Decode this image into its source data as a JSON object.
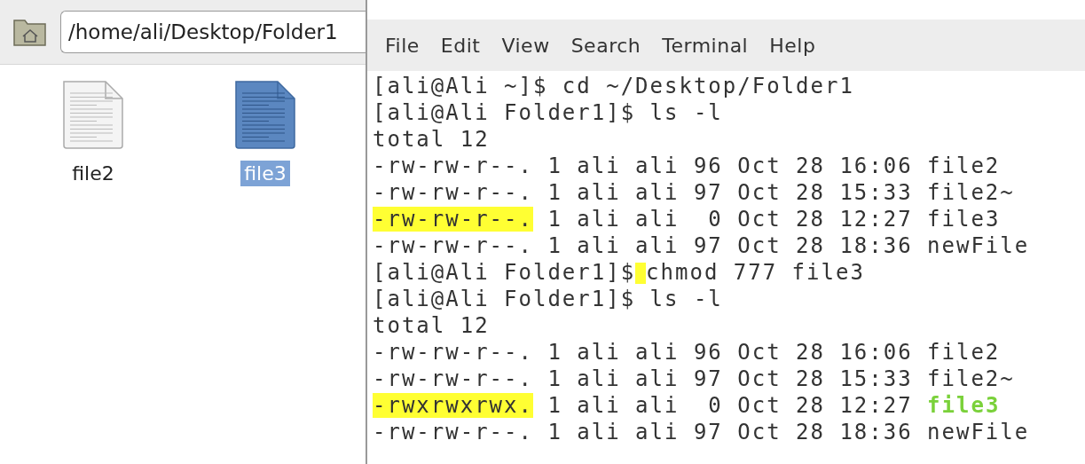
{
  "file_manager": {
    "location": "/home/ali/Desktop/Folder1",
    "files": [
      {
        "name": "file2",
        "selected": false
      },
      {
        "name": "file3",
        "selected": true
      }
    ]
  },
  "terminal": {
    "menu": [
      "File",
      "Edit",
      "View",
      "Search",
      "Terminal",
      "Help"
    ],
    "lines": [
      {
        "segments": [
          {
            "text": "[ali@Ali ~]$ cd ~/Desktop/Folder1",
            "kind": "plain",
            "highlighted": false
          }
        ]
      },
      {
        "segments": [
          {
            "text": "[ali@Ali Folder1]$ ls -l",
            "kind": "plain",
            "highlighted": false
          }
        ]
      },
      {
        "segments": [
          {
            "text": "total 12",
            "kind": "plain",
            "highlighted": false
          }
        ]
      },
      {
        "segments": [
          {
            "text": "-rw-rw-r--. 1 ali ali 96 Oct 28 16:06 file2",
            "kind": "plain",
            "highlighted": false
          }
        ]
      },
      {
        "segments": [
          {
            "text": "-rw-rw-r--. 1 ali ali 97 Oct 28 15:33 file2~",
            "kind": "plain",
            "highlighted": false
          }
        ]
      },
      {
        "segments": [
          {
            "text": "-rw-rw-r--.",
            "kind": "plain",
            "highlighted": true
          },
          {
            "text": " 1 ali ali  0 Oct 28 12:27 file3",
            "kind": "plain",
            "highlighted": false
          }
        ]
      },
      {
        "segments": [
          {
            "text": "-rw-rw-r--. 1 ali ali 97 Oct 28 18:36 newFile",
            "kind": "plain",
            "highlighted": false
          }
        ]
      },
      {
        "segments": [
          {
            "text": "[ali@Ali Folder1]$",
            "kind": "plain",
            "highlighted": false
          },
          {
            "kind": "cursor",
            "highlighted": true
          },
          {
            "text": "chmod 777 file3",
            "kind": "plain",
            "highlighted": false
          }
        ]
      },
      {
        "segments": [
          {
            "text": "[ali@Ali Folder1]$ ls -l",
            "kind": "plain",
            "highlighted": false
          }
        ]
      },
      {
        "segments": [
          {
            "text": "total 12",
            "kind": "plain",
            "highlighted": false
          }
        ]
      },
      {
        "segments": [
          {
            "text": "-rw-rw-r--. 1 ali ali 96 Oct 28 16:06 file2",
            "kind": "plain",
            "highlighted": false
          }
        ]
      },
      {
        "segments": [
          {
            "text": "-rw-rw-r--. 1 ali ali 97 Oct 28 15:33 file2~",
            "kind": "plain",
            "highlighted": false
          }
        ]
      },
      {
        "segments": [
          {
            "text": "-rwxrwxrwx.",
            "kind": "plain",
            "highlighted": true
          },
          {
            "text": " 1 ali ali  0 Oct 28 12:27 ",
            "kind": "plain",
            "highlighted": false
          },
          {
            "text": "file3",
            "kind": "executable",
            "highlighted": false
          }
        ]
      },
      {
        "segments": [
          {
            "text": "-rw-rw-r--. 1 ali ali 97 Oct 28 18:36 newFile",
            "kind": "plain",
            "highlighted": false
          }
        ]
      }
    ]
  }
}
